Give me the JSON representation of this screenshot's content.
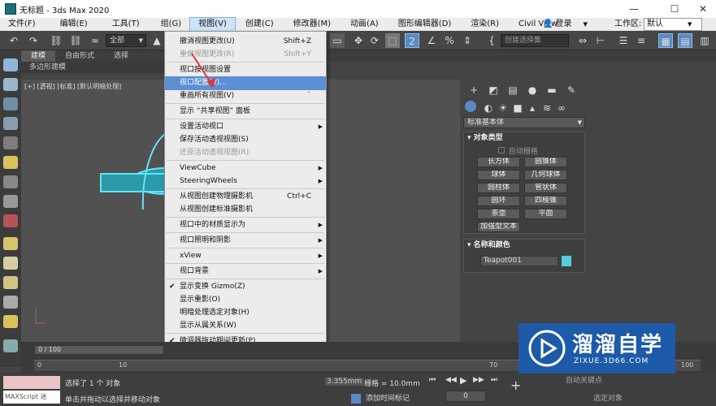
{
  "title_bar": {
    "title": "无标题 - 3ds Max 2020",
    "minimize": "—",
    "maximize": "☐",
    "close": "✕"
  },
  "menu_bar": {
    "items": [
      "文件(F)",
      "编辑(E)",
      "工具(T)",
      "组(G)",
      "视图(V)",
      "创建(C)",
      "修改器(M)",
      "动画(A)",
      "图形编辑器(D)",
      "渲染(R)",
      "Civil View"
    ],
    "login": "登录",
    "workspace_label": "工作区:",
    "workspace_value": "默认"
  },
  "toolbar": {
    "selection_filter": "全部",
    "named_selection_placeholder": "创建选择集"
  },
  "ribbon": {
    "tabs": [
      "建模",
      "自由形式",
      "选择"
    ],
    "subtitle": "多边形建模"
  },
  "viewport": {
    "label": "[+] [透视] [标准] [默认明暗处理]"
  },
  "view_menu": {
    "items": [
      {
        "label": "撤消视图更改(U)",
        "shortcut": "Shift+Z",
        "disabled": false
      },
      {
        "label": "重做视图更改(R)",
        "shortcut": "Shift+Y",
        "disabled": true
      },
      {
        "separator": true
      },
      {
        "label": "视口按视图设置",
        "shortcut": "",
        "disabled": false
      },
      {
        "label": "视口配置(V)...",
        "shortcut": "",
        "disabled": false,
        "highlighted": true
      },
      {
        "label": "重画所有视图(V)",
        "shortcut": "`",
        "disabled": false
      },
      {
        "separator": true
      },
      {
        "label": "显示 “共享视图” 面板",
        "shortcut": "",
        "disabled": false
      },
      {
        "separator": true
      },
      {
        "label": "设置活动视口",
        "shortcut": "",
        "submenu": true
      },
      {
        "label": "保存活动透视视图(S)",
        "shortcut": ""
      },
      {
        "label": "还原活动透视视图(R)",
        "shortcut": "",
        "disabled": true
      },
      {
        "separator": true
      },
      {
        "label": "ViewCube",
        "shortcut": "",
        "submenu": true
      },
      {
        "label": "SteeringWheels",
        "shortcut": "",
        "submenu": true
      },
      {
        "separator": true
      },
      {
        "label": "从视图创建物理摄影机",
        "shortcut": "Ctrl+C"
      },
      {
        "label": "从视图创建标准摄影机",
        "shortcut": ""
      },
      {
        "separator": true
      },
      {
        "label": "视口中的材质显示为",
        "shortcut": "",
        "submenu": true
      },
      {
        "separator": true
      },
      {
        "label": "视口照明和阴影",
        "shortcut": "",
        "submenu": true
      },
      {
        "separator": true
      },
      {
        "label": "xView",
        "shortcut": "",
        "submenu": true
      },
      {
        "separator": true
      },
      {
        "label": "视口背景",
        "shortcut": "",
        "submenu": true
      },
      {
        "separator": true
      },
      {
        "label": "显示变换 Gizmo(Z)",
        "shortcut": "",
        "checked": true
      },
      {
        "label": "显示重影(O)",
        "shortcut": ""
      },
      {
        "label": "明暗处理选定对象(H)",
        "shortcut": ""
      },
      {
        "label": "显示从属关系(W)",
        "shortcut": ""
      },
      {
        "separator": true
      },
      {
        "label": "微调器拖动期间更新(P)",
        "shortcut": "",
        "checked": true
      },
      {
        "label": "渐进式显示",
        "shortcut": "",
        "checked": true
      },
      {
        "separator": true
      },
      {
        "label": "专家模式(E)",
        "shortcut": "Ctrl+X"
      }
    ]
  },
  "command_panel": {
    "category": "标准基本体",
    "object_type_header": "对象类型",
    "autogrid_label": "自动栅格",
    "buttons": [
      "长方体",
      "圆锥体",
      "球体",
      "几何球体",
      "圆柱体",
      "管状体",
      "圆环",
      "四棱锥",
      "茶壶",
      "平面",
      "加强型文本"
    ],
    "name_color_header": "名称和颜色",
    "object_name": "Teapot001",
    "object_color": "#55cde0"
  },
  "timeline": {
    "frame_counter": "0 / 100",
    "ticks": [
      "0",
      "10",
      "70",
      "80",
      "90",
      "100"
    ]
  },
  "status_bar": {
    "maxscript_label": "MAXScript 迷",
    "selected_text": "选择了 1 个 对象",
    "hint_text": "单击并拖动以选择并移动对象",
    "coord_partial": "3.355mm",
    "grid_text": "栅格 = 10.0mm",
    "add_time_tag": "添加时间标记",
    "keyframe_value": "0",
    "auto_key": "自动关键点",
    "selected_obj": "选定对象"
  },
  "watermark": {
    "title": "溜溜自学",
    "url": "ZIXUE.3D66.COM"
  }
}
